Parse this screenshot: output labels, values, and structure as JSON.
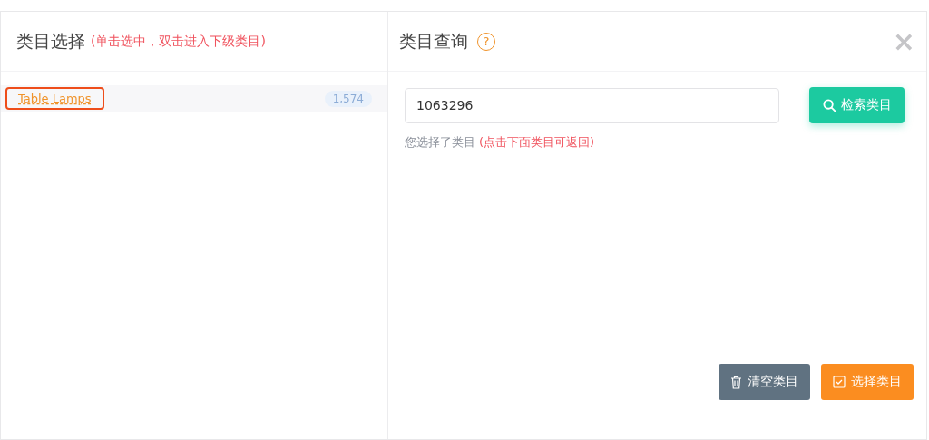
{
  "left_panel": {
    "title": "类目选择",
    "hint": "(单击选中，双击进入下级类目)",
    "items": [
      {
        "label": "Table Lamps",
        "count": "1,574",
        "selected": true
      }
    ]
  },
  "right_panel": {
    "title": "类目查询",
    "help_icon": "?",
    "close": "×",
    "search": {
      "value": "1063296",
      "button": "检索类目"
    },
    "selection_note": "您选择了类目",
    "selection_hint": "(点击下面类目可返回)",
    "buttons": [
      {
        "kind": "clear",
        "label": "清空类目"
      },
      {
        "kind": "select",
        "label": "选择类目"
      }
    ]
  }
}
